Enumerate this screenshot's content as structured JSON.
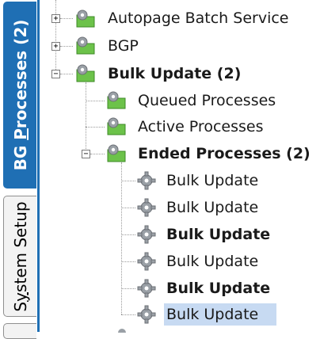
{
  "tabs": [
    {
      "label_main": "BG ",
      "label_under": "P",
      "label_rest": "rocesses (2)",
      "active": true
    },
    {
      "label_main": "S",
      "label_under": "y",
      "label_rest": "stem Setup",
      "active": false
    }
  ],
  "tree": {
    "nodes": [
      {
        "label": "Autopage Batch Service",
        "bold": false,
        "expander": "+",
        "icon": "folder-gear-icon"
      },
      {
        "label": "BGP",
        "bold": false,
        "expander": "+",
        "icon": "folder-gear-icon"
      },
      {
        "label": "Bulk Update (2)",
        "bold": true,
        "expander": "−",
        "icon": "folder-gear-icon"
      },
      {
        "label": "Queued Processes",
        "bold": false,
        "icon": "folder-gear-icon"
      },
      {
        "label": "Active Processes",
        "bold": false,
        "icon": "folder-gear-icon"
      },
      {
        "label": "Ended Processes (2)",
        "bold": true,
        "expander": "−",
        "icon": "folder-gear-icon"
      },
      {
        "label": "Bulk Update",
        "bold": false,
        "icon": "gear-icon"
      },
      {
        "label": "Bulk Update",
        "bold": false,
        "icon": "gear-icon"
      },
      {
        "label": "Bulk Update",
        "bold": true,
        "icon": "gear-icon"
      },
      {
        "label": "Bulk Update",
        "bold": false,
        "icon": "gear-icon"
      },
      {
        "label": "Bulk Update",
        "bold": true,
        "icon": "gear-icon"
      },
      {
        "label": "Bulk Update",
        "bold": false,
        "icon": "gear-icon",
        "selected": true
      }
    ]
  },
  "colors": {
    "accent": "#1f6fb4",
    "selection": "#c7daf2",
    "folder": "#6cc24a",
    "gear": "#8a8f96"
  }
}
